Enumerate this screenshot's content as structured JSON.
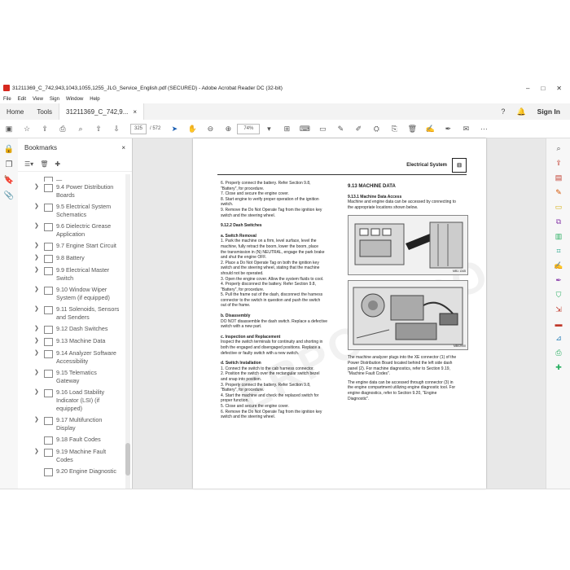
{
  "window": {
    "title": "31211369_C_742,943,1043,1055,1255_JLG_Service_English.pdf (SECURED) - Adobe Acrobat Reader DC (32-bit)",
    "controls": [
      "–",
      "□",
      "✕"
    ]
  },
  "menu": [
    "File",
    "Edit",
    "View",
    "Sign",
    "Window",
    "Help"
  ],
  "tabs": {
    "home": "Home",
    "tools": "Tools",
    "doc": "31211369_C_742,9...",
    "doc_close": "×",
    "sign_in": "Sign In"
  },
  "toolbar": {
    "page_current": "325",
    "page_total": "/ 572",
    "zoom": "74%"
  },
  "bookmarks": {
    "title": "Bookmarks",
    "close": "×",
    "items": [
      {
        "label": "9.4 Power Distribution Boards",
        "expandable": true
      },
      {
        "label": "9.5 Electrical System Schematics",
        "expandable": true
      },
      {
        "label": "9.6 Dielectric Grease Application",
        "expandable": true
      },
      {
        "label": "9.7 Engine Start Circuit",
        "expandable": true
      },
      {
        "label": "9.8 Battery",
        "expandable": true
      },
      {
        "label": "9.9 Electrical Master Switch",
        "expandable": true
      },
      {
        "label": "9.10 Window Wiper System (if equipped)",
        "expandable": true
      },
      {
        "label": "9.11 Solenoids, Sensors and Senders",
        "expandable": true
      },
      {
        "label": "9.12 Dash Switches",
        "expandable": true
      },
      {
        "label": "9.13 Machine Data",
        "expandable": true
      },
      {
        "label": "9.14 Analyzer Software Accessibility",
        "expandable": true
      },
      {
        "label": "9.15 Telematics Gateway",
        "expandable": true
      },
      {
        "label": "9.16 Load Stability Indicator (LSI) (if equipped)",
        "expandable": true
      },
      {
        "label": "9.17 Multifunction Display",
        "expandable": true
      },
      {
        "label": "9.18 Fault Codes",
        "expandable": false
      },
      {
        "label": "9.19 Machine Fault Codes",
        "expandable": true
      },
      {
        "label": "9.20 Engine Diagnostic",
        "expandable": false
      }
    ]
  },
  "page": {
    "header": "Electrical System",
    "watermark": "ERPOAERO",
    "left_column": [
      {
        "t": "6.  Properly connect the battery. Refer Section 9.8,",
        "s": "p"
      },
      {
        "t": "     \"Battery\", for procedure.",
        "s": "p"
      },
      {
        "t": "7.  Close and secure the engine cover.",
        "s": "p"
      },
      {
        "t": "8.  Start engine to verify proper operation of the ignition",
        "s": "p"
      },
      {
        "t": "     switch.",
        "s": "p"
      },
      {
        "t": "9.  Remove the Do Not Operate Tag from the ignition key",
        "s": "p"
      },
      {
        "t": "     switch and the steering wheel.",
        "s": "p"
      },
      {
        "t": "9.12.2        Dash Switches",
        "s": "h"
      },
      {
        "t": "a.   Switch Removal",
        "s": "h"
      },
      {
        "t": "1.  Park the machine on a firm, level surface, level the",
        "s": "p"
      },
      {
        "t": "     machine, fully retract the boom, lower the boom, place",
        "s": "p"
      },
      {
        "t": "     the transmission in (N) NEUTRAL, engage the park brake",
        "s": "p"
      },
      {
        "t": "     and shut the engine OFF.",
        "s": "p"
      },
      {
        "t": "2.  Place a Do Not Operate Tag on both the ignition key",
        "s": "p"
      },
      {
        "t": "     switch and the steering wheel, stating that the machine",
        "s": "p"
      },
      {
        "t": "     should not be operated.",
        "s": "p"
      },
      {
        "t": "3.  Open the engine cover. Allow the system fluids to cool.",
        "s": "p"
      },
      {
        "t": "4.  Properly disconnect the battery. Refer Section 9.8,",
        "s": "p"
      },
      {
        "t": "     \"Battery\", for procedure.",
        "s": "p"
      },
      {
        "t": "5.  Pull the frame out of the dash, disconnect the harness",
        "s": "p"
      },
      {
        "t": "     connector to the switch in question and push the switch",
        "s": "p"
      },
      {
        "t": "     out of the frame.",
        "s": "p"
      },
      {
        "t": "b.   Disassembly",
        "s": "h"
      },
      {
        "t": "DO NOT disassemble the dash switch. Replace a defective",
        "s": "p"
      },
      {
        "t": "switch with a new part.",
        "s": "p"
      },
      {
        "t": "c.   Inspection and Replacement",
        "s": "h"
      },
      {
        "t": "Inspect the switch terminals for continuity and shorting in",
        "s": "p"
      },
      {
        "t": "both the engaged and disengaged positions. Replace a",
        "s": "p"
      },
      {
        "t": "defective or faulty switch with a new switch.",
        "s": "p"
      },
      {
        "t": "d.   Switch Installation",
        "s": "h"
      },
      {
        "t": "1.  Connect the switch to the cab harness connector.",
        "s": "p"
      },
      {
        "t": "2.  Position the switch over the rectangular switch bezel",
        "s": "p"
      },
      {
        "t": "     and snap into position.",
        "s": "p"
      },
      {
        "t": "3.  Properly connect the battery. Refer Section 9.8,",
        "s": "p"
      },
      {
        "t": "     \"Battery\", for procedure.",
        "s": "p"
      },
      {
        "t": "4.  Start the machine and check the replaced switch for",
        "s": "p"
      },
      {
        "t": "     proper function.",
        "s": "p"
      },
      {
        "t": "5.  Close and secure the engine cover.",
        "s": "p"
      },
      {
        "t": "6.  Remove the Do Not Operate Tag from the ignition key",
        "s": "p"
      },
      {
        "t": "     switch and the steering wheel.",
        "s": "p"
      }
    ],
    "right_heading": "9.13      MACHINE DATA",
    "right_subheading": "9.13.1        Machine Data Access",
    "right_intro": [
      "Machine and engine data can be accessed by connecting to",
      "the appropriate locations shown below."
    ],
    "fig1_caption": "MB1 1345",
    "fig2_caption": "MB02900",
    "right_after": [
      "The machine analyzer plugs into the XE connector (1) of the",
      "Power Distribution Board located behind the left side dash",
      "panel (2). For machine diagnostics, refer to Section 9.19,",
      "\"Machine Fault Codes\".",
      "",
      "The engine data can be accessed through connector (3) in",
      "the engine compartment utilizing engine diagnostic tool. For",
      "engine diagnostics, refer to Section 9.20, \"Engine",
      "Diagnostic\"."
    ]
  }
}
